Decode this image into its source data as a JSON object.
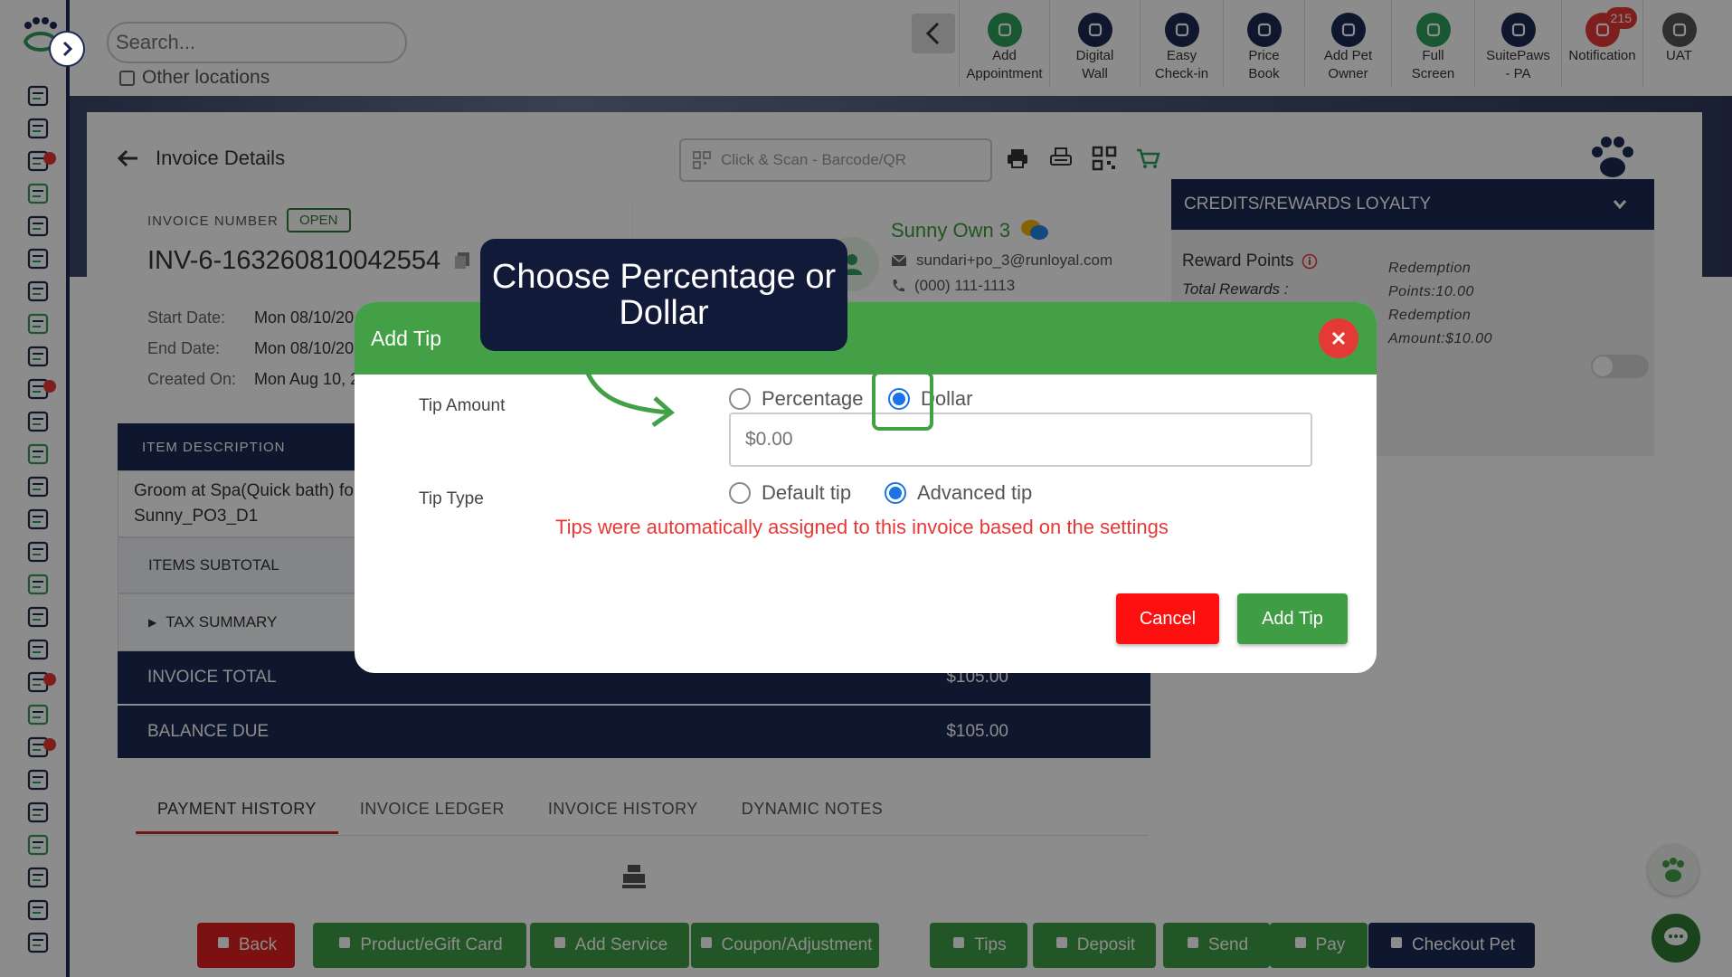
{
  "search": {
    "placeholder": "Search...",
    "other_locations": "Other locations"
  },
  "toolbar": {
    "items": [
      {
        "line1": "Add",
        "line2": "Appointment",
        "icon": "calendar-plus-icon",
        "color": "#2e9e5b"
      },
      {
        "line1": "Digital",
        "line2": "Wall",
        "icon": "monitor-icon",
        "color": "#1d2a57"
      },
      {
        "line1": "Easy",
        "line2": "Check-in",
        "icon": "paw-icon",
        "color": "#1d2a57"
      },
      {
        "line1": "Price",
        "line2": "Book",
        "icon": "document-icon",
        "color": "#1d2a57"
      },
      {
        "line1": "Add Pet",
        "line2": "Owner",
        "icon": "add-user-icon",
        "color": "#1d2a57"
      },
      {
        "line1": "Full",
        "line2": "Screen",
        "icon": "fullscreen-icon",
        "color": "#2e9e5b"
      },
      {
        "line1": "SuitePaws",
        "line2": "- PA",
        "icon": "location-icon",
        "color": "#1d2a57"
      },
      {
        "line1": "Notification",
        "line2": "",
        "icon": "bell-icon",
        "color": "#e53935",
        "badge": "215"
      },
      {
        "line1": "UAT",
        "line2": "",
        "icon": "avatar",
        "color": "#555555"
      }
    ]
  },
  "invoice": {
    "title": "Invoice Details",
    "scan_placeholder": "Click & Scan - Barcode/QR",
    "number_label": "INVOICE NUMBER",
    "status": "OPEN",
    "number": "INV-6-163260810042554",
    "dates": [
      {
        "label": "Start Date:",
        "value": "Mon 08/10/20"
      },
      {
        "label": "End Date:",
        "value": "Mon 08/10/20"
      },
      {
        "label": "Created On:",
        "value": "Mon Aug 10, 2"
      }
    ]
  },
  "owner": {
    "name": "Sunny Own 3",
    "email": "sundari+po_3@runloyal.com",
    "phone": "(000) 111-1113"
  },
  "items": {
    "header": "ITEM DESCRIPTION",
    "row_line1": "Groom at Spa(Quick bath) fo",
    "row_line2": "Sunny_PO3_D1",
    "subtotal_label": "ITEMS SUBTOTAL",
    "tax_label": "TAX SUMMARY",
    "total_label": "INVOICE TOTAL",
    "total_value": "$105.00",
    "balance_label": "BALANCE DUE",
    "balance_value": "$105.00"
  },
  "tabs": [
    "PAYMENT HISTORY",
    "INVOICE LEDGER",
    "INVOICE HISTORY",
    "DYNAMIC NOTES"
  ],
  "loyalty": {
    "title": "CREDITS/REWARDS LOYALTY",
    "reward_points": "Reward Points",
    "total_rewards": "Total Rewards :",
    "redemption_lines": [
      "Redemption",
      "Points:10.00",
      "Redemption",
      "Amount:$10.00"
    ]
  },
  "bottom_buttons": [
    {
      "label": "Back",
      "style": "red",
      "icon": "arrow-left-icon"
    },
    {
      "label": "Product/eGift Card",
      "style": "green",
      "icon": "gift-icon"
    },
    {
      "label": "Add Service",
      "style": "green",
      "icon": "bell-service-icon"
    },
    {
      "label": "Coupon/Adjustment",
      "style": "green",
      "icon": "tag-icon"
    },
    {
      "label": "Tips",
      "style": "green",
      "icon": "hand-coin-icon"
    },
    {
      "label": "Deposit",
      "style": "green",
      "icon": "piggy-bank-icon"
    },
    {
      "label": "Send",
      "style": "green",
      "icon": "send-icon"
    },
    {
      "label": "Pay",
      "style": "green",
      "icon": "card-icon"
    },
    {
      "label": "Checkout Pet",
      "style": "navy",
      "icon": "paw-icon"
    }
  ],
  "modal": {
    "title": "Add Tip",
    "tip_amount_label": "Tip Amount",
    "option_percentage": "Percentage",
    "option_dollar": "Dollar",
    "selected_amount_option": "Dollar",
    "amount_placeholder": "$0.00",
    "tip_type_label": "Tip Type",
    "option_default": "Default tip",
    "option_advanced": "Advanced tip",
    "selected_type_option": "Advanced tip",
    "info": "Tips were automatically assigned to this invoice based on the settings",
    "cancel": "Cancel",
    "add": "Add Tip"
  },
  "callout": {
    "text": "Choose Percentage or Dollar"
  },
  "colors": {
    "navy": "#1b2a52",
    "green": "#43a047",
    "red": "#e53935",
    "accent_blue": "#1a73e8"
  }
}
